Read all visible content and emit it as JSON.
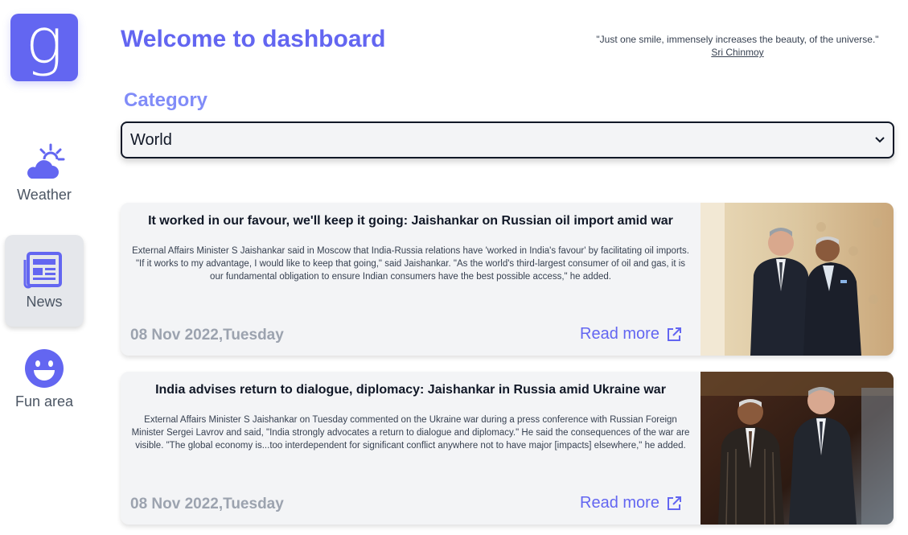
{
  "sidebar": {
    "logo_letter": "g",
    "items": [
      {
        "label": "Weather",
        "icon": "weather-cloud-sun-icon"
      },
      {
        "label": "News",
        "icon": "newspaper-icon",
        "active": true
      },
      {
        "label": "Fun area",
        "icon": "smile-face-icon"
      }
    ]
  },
  "header": {
    "title": "Welcome to dashboard",
    "quote": "\"Just one smile, immensely increases the beauty, of the universe.\"",
    "quote_author": "Sri Chinmoy"
  },
  "category": {
    "label": "Category",
    "selected": "World"
  },
  "articles": [
    {
      "title": "It worked in our favour, we'll keep it going: Jaishankar on Russian oil import amid war",
      "description": "External Affairs Minister S Jaishankar said in Moscow that India-Russia relations have 'worked in India's favour' by facilitating oil imports. \"If it works to my advantage, I would like to keep that going,\" said Jaishankar. \"As the world's third-largest consumer of oil and gas, it is our fundamental obligation to ensure Indian consumers have the best possible access,\" he added.",
      "date": "08 Nov 2022,Tuesday",
      "read_more": "Read more"
    },
    {
      "title": "India advises return to dialogue, diplomacy: Jaishankar in Russia amid Ukraine war",
      "description": "External Affairs Minister S Jaishankar on Tuesday commented on the Ukraine war during a press conference with Russian Foreign Minister Sergei Lavrov and said, \"India strongly advocates a return to dialogue and diplomacy.\" He said the consequences of the war are visible. \"The global economy is...too interdependent for significant conflict anywhere not to have major [impacts] elsewhere,\" he added.",
      "date": "08 Nov 2022,Tuesday",
      "read_more": "Read more"
    }
  ],
  "colors": {
    "accent": "#6366f1",
    "accent_light": "#818cf8",
    "card_bg": "#f3f4f6",
    "date_gray": "#9ca3af"
  }
}
